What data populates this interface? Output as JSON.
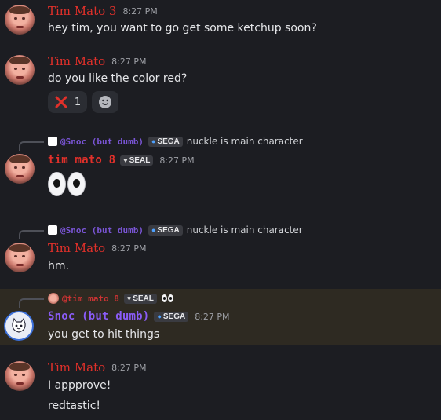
{
  "messages": [
    {
      "author": "Tim Mato 3",
      "time": "8:27 PM",
      "text": "hey tim, you want to go get some ketchup soon?"
    },
    {
      "author": "Tim Mato",
      "time": "8:27 PM",
      "text": "do you like the color red?",
      "reactions": [
        {
          "emoji": "cross-mark",
          "count": "1"
        },
        {
          "emoji": "add-reaction"
        }
      ]
    },
    {
      "reply": {
        "author": "@Snoc (but dumb)",
        "tag": "SEGA",
        "text": "nuckle is main character"
      },
      "author": "tim mato 8",
      "tag": "SEAL",
      "time": "8:27 PM",
      "text": "👀"
    },
    {
      "reply": {
        "author": "@Snoc (but dumb)",
        "tag": "SEGA",
        "text": "nuckle is main character"
      },
      "author": "Tim Mato",
      "time": "8:27 PM",
      "text": "hm."
    },
    {
      "reply": {
        "author": "@tim mato 8",
        "tag": "SEAL",
        "text": "👀"
      },
      "author": "Snoc (but dumb)",
      "tag": "SEGA",
      "time": "8:27 PM",
      "text": "you get to hit things"
    },
    {
      "author": "Tim Mato",
      "time": "8:27 PM",
      "text": "I appprove!",
      "text2": "redtastic!"
    }
  ],
  "colors": {
    "background": "#1c1d22",
    "highlight": "#2e2a22",
    "red_name": "#e0302a",
    "purple_name": "#8a5cf6"
  }
}
